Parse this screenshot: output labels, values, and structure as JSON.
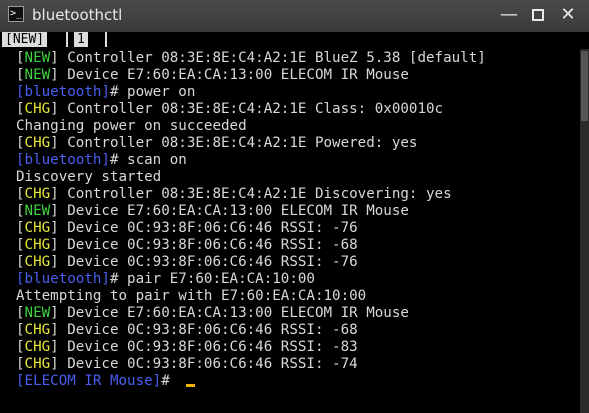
{
  "window": {
    "title": "bluetoothctl",
    "icon": "terminal-icon",
    "controls": {
      "minimize": "—",
      "close": "✕"
    }
  },
  "tabs": [
    {
      "label": "[NEW]"
    },
    {
      "label": "1"
    }
  ],
  "terminal": {
    "lines": [
      {
        "tag": "NEW",
        "text": "Controller 08:3E:8E:C4:A2:1E BlueZ 5.38 [default]"
      },
      {
        "tag": "NEW",
        "text": "Device E7:60:EA:CA:13:00 ELECOM IR Mouse"
      },
      {
        "prompt": "bluetooth",
        "text": "# power on"
      },
      {
        "tag": "CHG",
        "text": "Controller 08:3E:8E:C4:A2:1E Class: 0x00010c"
      },
      {
        "text": "Changing power on succeeded"
      },
      {
        "tag": "CHG",
        "text": "Controller 08:3E:8E:C4:A2:1E Powered: yes"
      },
      {
        "prompt": "bluetooth",
        "text": "# scan on"
      },
      {
        "text": "Discovery started"
      },
      {
        "tag": "CHG",
        "text": "Controller 08:3E:8E:C4:A2:1E Discovering: yes"
      },
      {
        "tag": "NEW",
        "text": "Device E7:60:EA:CA:13:00 ELECOM IR Mouse"
      },
      {
        "tag": "CHG",
        "text": "Device 0C:93:8F:06:C6:46 RSSI: -76"
      },
      {
        "tag": "CHG",
        "text": "Device 0C:93:8F:06:C6:46 RSSI: -68"
      },
      {
        "tag": "CHG",
        "text": "Device 0C:93:8F:06:C6:46 RSSI: -76"
      },
      {
        "prompt": "bluetooth",
        "text": "# pair E7:60:EA:CA:10:00"
      },
      {
        "text": "Attempting to pair with E7:60:EA:CA:10:00"
      },
      {
        "tag": "NEW",
        "text": "Device E7:60:EA:CA:13:00 ELECOM IR Mouse"
      },
      {
        "tag": "CHG",
        "text": "Device 0C:93:8F:06:C6:46 RSSI: -68"
      },
      {
        "tag": "CHG",
        "text": "Device 0C:93:8F:06:C6:46 RSSI: -83"
      },
      {
        "tag": "CHG",
        "text": "Device 0C:93:8F:06:C6:46 RSSI: -74"
      },
      {
        "prompt": "ELECOM IR Mouse",
        "text": "# ",
        "cursor": true
      }
    ]
  },
  "colors": {
    "background": "#000000",
    "text": "#d8d8d8",
    "tag_new": "#3fd43f",
    "tag_chg": "#e8e83a",
    "prompt": "#4a5ef0",
    "cursor": "#f0b400",
    "titlebar": "#404040"
  }
}
